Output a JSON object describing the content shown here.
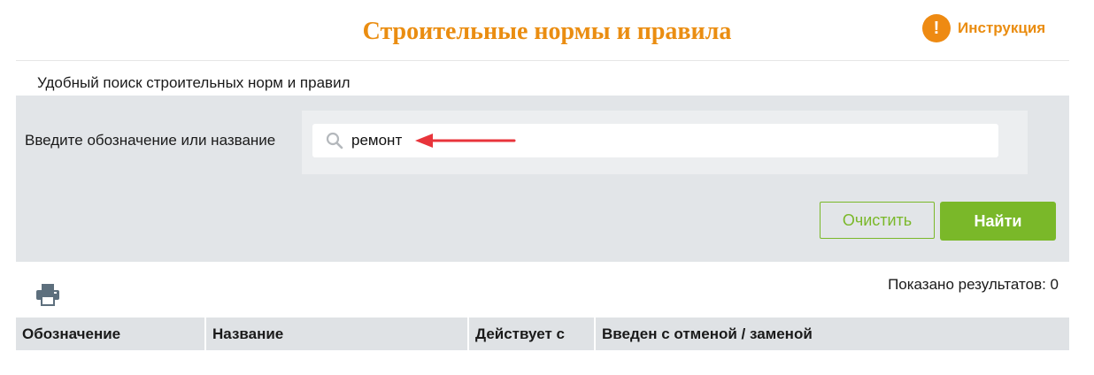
{
  "colors": {
    "title": "#ea8d11",
    "instruction_icon_bg": "#ee8a12",
    "instruction_text": "#ea8d11",
    "accent_green": "#7ab829",
    "arrow_red": "#e8343b",
    "panel_bg": "#e2e5e8",
    "table_header_bg": "#dfe2e5"
  },
  "header": {
    "title": "Строительные нормы и правила",
    "instruction_icon_glyph": "!",
    "instruction_label": "Инструкция"
  },
  "subtitle": "Удобный поиск строительных норм и правил",
  "search": {
    "label": "Введите обозначение или название",
    "value": "ремонт",
    "icon": "search-icon",
    "annotation_icon": "red-arrow-icon"
  },
  "buttons": {
    "clear": "Очистить",
    "find": "Найти"
  },
  "toolbar": {
    "print_icon": "print-icon"
  },
  "results": {
    "count_text": "Показано результатов: 0"
  },
  "table": {
    "columns": [
      "Обозначение",
      "Название",
      "Действует с",
      "Введен с отменой / заменой"
    ]
  }
}
